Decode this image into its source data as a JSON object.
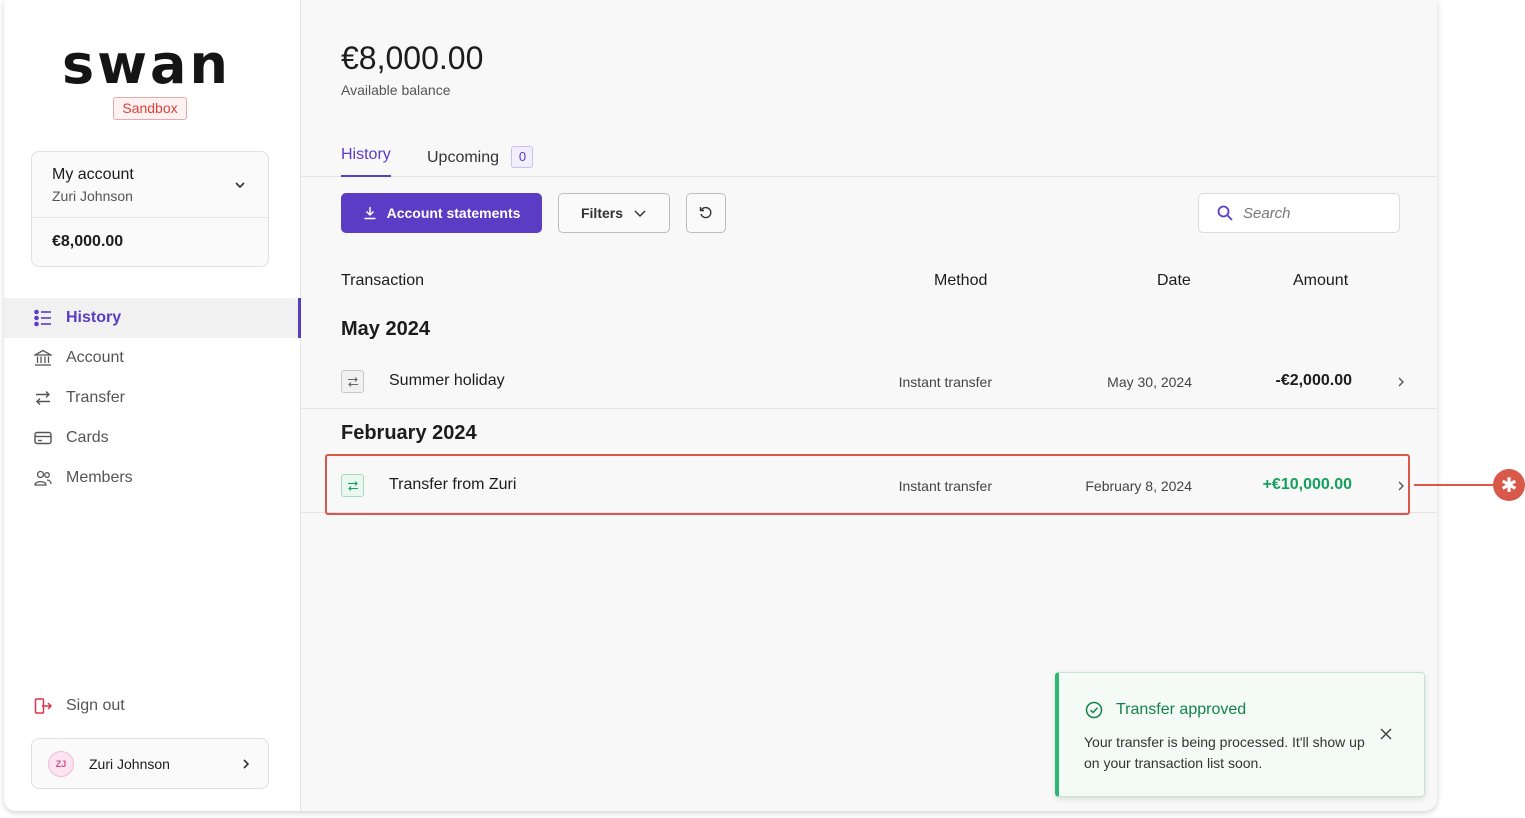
{
  "sidebar": {
    "logo": "swan",
    "env_badge": "Sandbox",
    "account": {
      "label": "My account",
      "holder": "Zuri Johnson",
      "balance": "€8,000.00"
    },
    "nav": [
      {
        "label": "History",
        "icon": "list-icon",
        "active": true
      },
      {
        "label": "Account",
        "icon": "bank-icon",
        "active": false
      },
      {
        "label": "Transfer",
        "icon": "transfer-arrows-icon",
        "active": false
      },
      {
        "label": "Cards",
        "icon": "card-icon",
        "active": false
      },
      {
        "label": "Members",
        "icon": "members-icon",
        "active": false
      }
    ],
    "sign_out": "Sign out",
    "user": {
      "initials": "ZJ",
      "name": "Zuri Johnson"
    }
  },
  "main": {
    "balance": "€8,000.00",
    "balance_label": "Available balance",
    "tabs": [
      {
        "label": "History",
        "active": true
      },
      {
        "label": "Upcoming",
        "count": "0"
      }
    ],
    "toolbar": {
      "statements_label": "Account statements",
      "filters_label": "Filters",
      "search_placeholder": "Search"
    },
    "table": {
      "headers": {
        "transaction": "Transaction",
        "method": "Method",
        "date": "Date",
        "amount": "Amount"
      },
      "groups": [
        {
          "label": "May 2024",
          "rows": [
            {
              "name": "Summer holiday",
              "method": "Instant transfer",
              "date": "May 30, 2024",
              "amount": "-€2,000.00"
            }
          ]
        },
        {
          "label": "February 2024",
          "rows": [
            {
              "name": "Transfer from Zuri",
              "method": "Instant transfer",
              "date": "February 8, 2024",
              "amount": "+€10,000.00"
            }
          ]
        }
      ]
    },
    "toast": {
      "title": "Transfer approved",
      "body": "Your transfer is being processed. It'll show up on your transaction list soon."
    }
  },
  "annotation": {
    "marker": "✱",
    "color": "#d8584a"
  },
  "colors": {
    "accent": "#5b3cc4",
    "positive": "#14a05a",
    "sandbox": "#d9423a"
  }
}
